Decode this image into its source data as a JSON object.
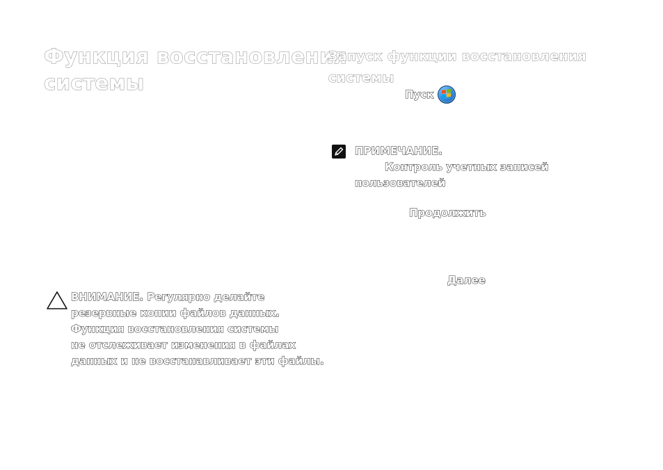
{
  "main_title": {
    "line1": "Функция восстановления",
    "line2": "системы"
  },
  "section_title": {
    "line1": "Запуск функции восстановления",
    "line2": "системы"
  },
  "start": {
    "label": "Пуск",
    "icon": "windows-start-orb-icon"
  },
  "note": {
    "icon": "pencil-note-icon",
    "title": "ПРИМЕЧАНИЕ.",
    "line2": "Контроль учетных записей",
    "line3": "пользователей"
  },
  "continue_label": "Продолжить",
  "next_label": "Далее",
  "warning": {
    "icon": "warning-triangle-icon",
    "line1_prefix": "ВНИМАНИЕ.",
    "line1_rest": " Регулярно делайте",
    "line2": "резервные копии файлов данных.",
    "line3": "Функция восстановления системы",
    "line4": "не отслеживает изменения в файлах",
    "line5": "данных и не восстанавливает эти файлы."
  },
  "colors": {
    "outline_dark": "#222222",
    "outline_light": "#8a8a8a",
    "start_orb": "#2f8fe0"
  }
}
